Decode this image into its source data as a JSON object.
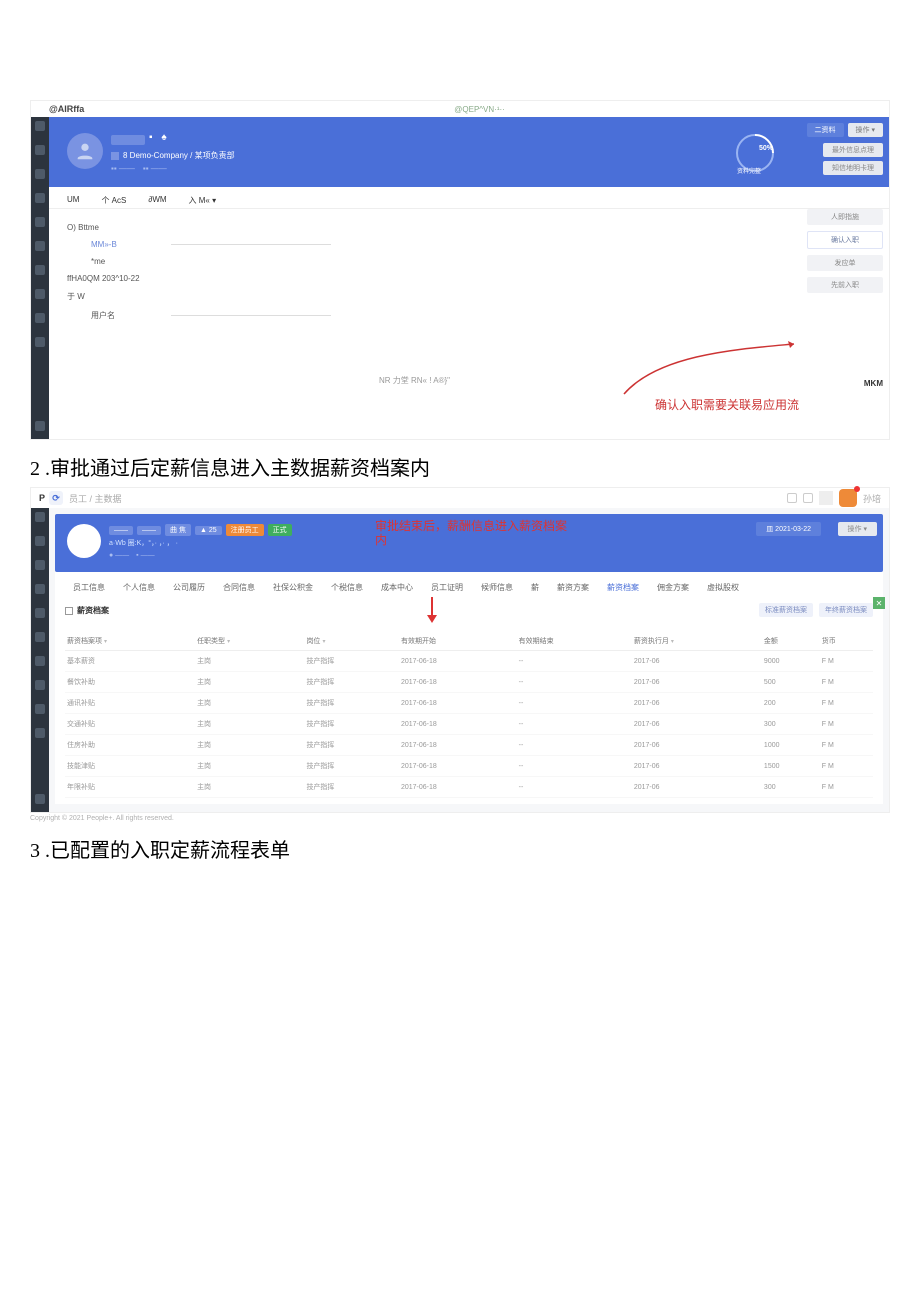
{
  "shot1": {
    "topbar_left": "@AIRffa",
    "topbar_mid": "@QEP^VN·¹··",
    "banner": {
      "dots": "▪  ♠",
      "sub1_icon": "■",
      "sub1_text": "8 Demo-Company / 某项负责部",
      "pct": "50%",
      "pct_label": "资料完整",
      "btn1": "二资料",
      "btn2": "操作 ▾",
      "act1": "最外信息点理",
      "act2": "知信地明卡理"
    },
    "tabs": [
      "UM",
      "个 AcS",
      "∂WM",
      "入  M« ▾"
    ],
    "form": {
      "r1": "O) Bttme",
      "r2": "MM»-B",
      "r3": "*me",
      "r4": "ffHA0QM 203^10-22",
      "r5": "于 W",
      "r6": "用户名",
      "mid_note": "NR 力堂 RN« ! A®}\""
    },
    "side": [
      "人即指施",
      "确认入职",
      "发应单",
      "先前入职"
    ],
    "red_text": "确认入职需要关联易应用流",
    "mkm": "MKM"
  },
  "step2": "2  .审批通过后定薪信息进入主数据薪资档案内",
  "shot2": {
    "logo": "P",
    "bc": "员工 / 主数据",
    "user": "孙培",
    "top_box_l": "⟳",
    "banner": {
      "chips": [
        "——",
        "——",
        "曲 焦",
        "▲ 25",
        "注册员工",
        "正式"
      ],
      "sub": "a·Wb 圈:K，°，· ，· ， ·",
      "anno": "审批结束后，薪酬信息进入薪资档案内",
      "date": "皿 2021-03-22",
      "op": "操作 ▾"
    },
    "tabs": [
      "员工信息",
      "个人信息",
      "公司履历",
      "合同信息",
      "社保公积金",
      "个税信息",
      "成本中心",
      "员工证明",
      "候师信息",
      "薪",
      "薪资方案",
      "薪资档案",
      "佣金方案",
      "虚拟股权"
    ],
    "sec_title": "薪资档案",
    "link_btns": [
      "标准薪资档案",
      "年终薪资档案"
    ],
    "columns": [
      "薪资档案项",
      "任职类型",
      "岗位",
      "有效期开始",
      "有效期结束",
      "薪资执行月",
      "金额",
      "货币"
    ],
    "caret": "▾",
    "rows": [
      [
        "基本薪资",
        "主岗",
        "技产指挥",
        "2017-06-18",
        "--",
        "2017-06",
        "9000",
        "F M"
      ],
      [
        "餐饮补助",
        "主岗",
        "技产指挥",
        "2017-06-18",
        "--",
        "2017-06",
        "500",
        "F M"
      ],
      [
        "通讯补贴",
        "主岗",
        "技产指挥",
        "2017-06-18",
        "--",
        "2017-06",
        "200",
        "F M"
      ],
      [
        "交通补贴",
        "主岗",
        "技产指挥",
        "2017-06-18",
        "--",
        "2017-06",
        "300",
        "F M"
      ],
      [
        "住房补助",
        "主岗",
        "技产指挥",
        "2017-06-18",
        "--",
        "2017-06",
        "1000",
        "F M"
      ],
      [
        "技能津贴",
        "主岗",
        "技产指挥",
        "2017-06-18",
        "--",
        "2017-06",
        "1500",
        "F M"
      ],
      [
        "年限补贴",
        "主岗",
        "技产指挥",
        "2017-06-18",
        "--",
        "2017-06",
        "300",
        "F M"
      ]
    ]
  },
  "copyright": "Copyright © 2021 People+. All rights reserved.",
  "step3": "3  .已配置的入职定薪流程表单"
}
